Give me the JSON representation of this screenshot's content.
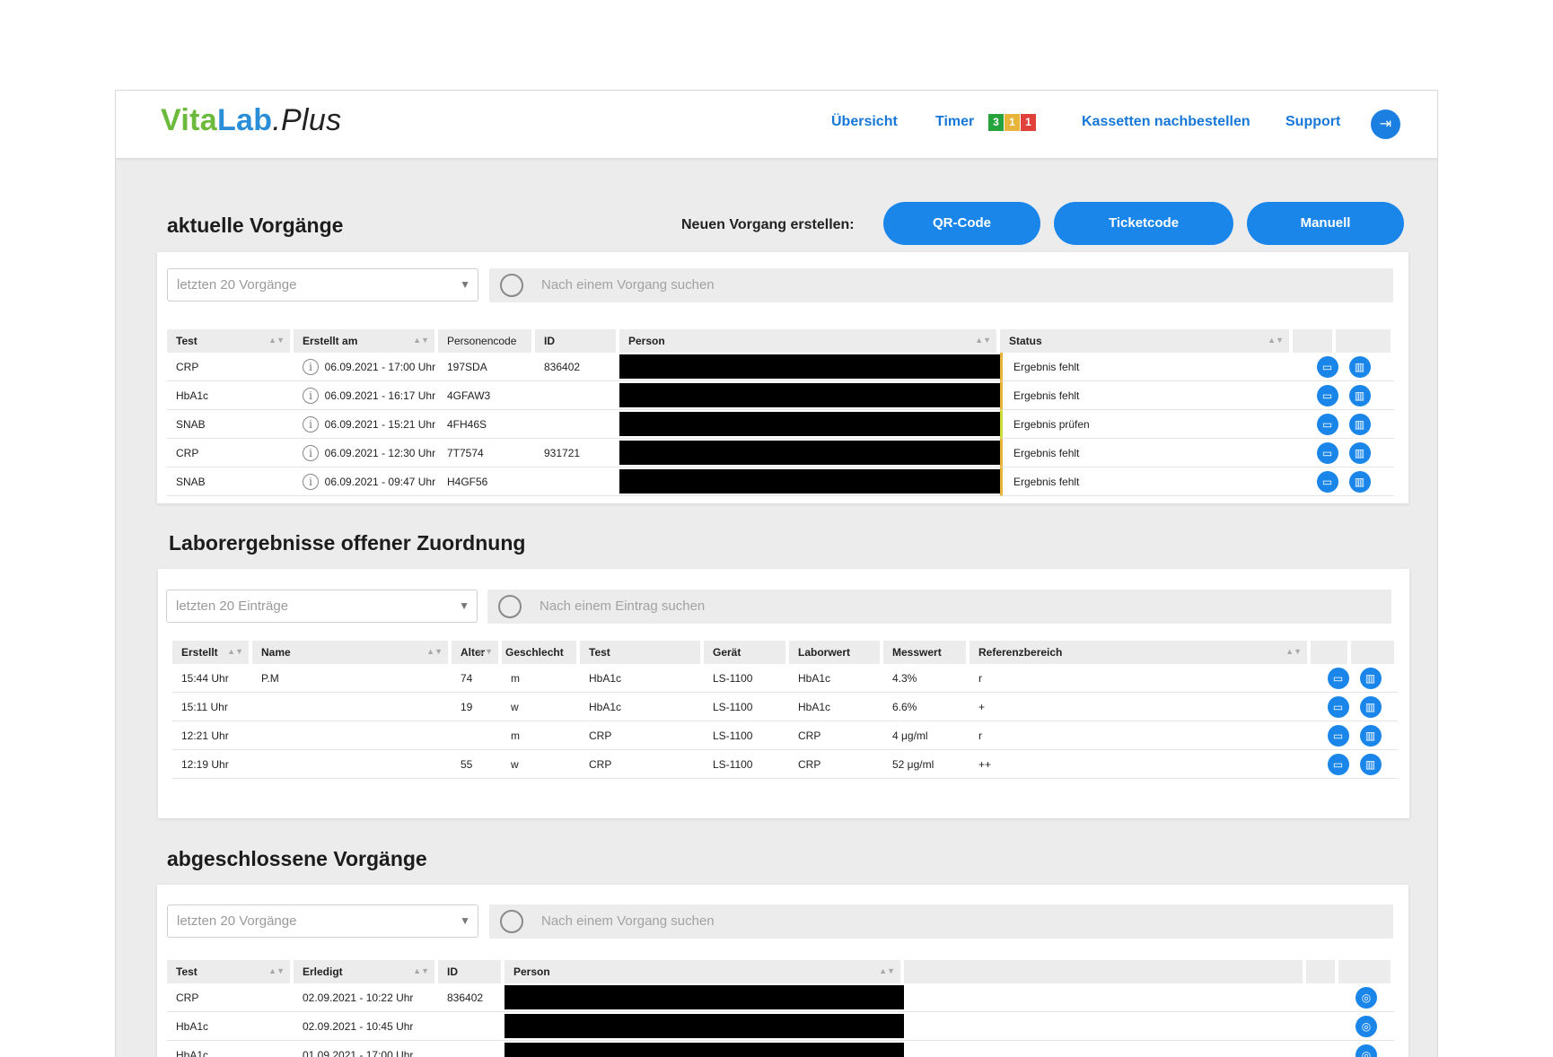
{
  "brand": {
    "part1": "Vita",
    "part2": "Lab",
    "part3": ".Plus"
  },
  "nav": {
    "overview": "Übersicht",
    "timer": "Timer",
    "timer_badges": [
      {
        "value": "3",
        "color": "#27a33e"
      },
      {
        "value": "1",
        "color": "#e9b43a"
      },
      {
        "value": "1",
        "color": "#e0413a"
      }
    ],
    "reorder": "Kassetten nachbestellen",
    "support": "Support"
  },
  "colors": {
    "accent": "#1a86ea",
    "status_missing": "#e9b43a",
    "status_check": "#cddc39"
  },
  "current": {
    "title": "aktuelle Vorgänge",
    "create_label": "Neuen Vorgang erstellen:",
    "buttons": {
      "qr": "QR-Code",
      "ticket": "Ticketcode",
      "manual": "Manuell"
    },
    "filter": "letzten 20 Vorgänge",
    "search_placeholder": "Nach einem Vorgang suchen",
    "columns": {
      "test": "Test",
      "created": "Erstellt am",
      "code": "Personencode",
      "id": "ID",
      "person": "Person",
      "status": "Status"
    },
    "rows": [
      {
        "test": "CRP",
        "created": "06.09.2021 - 17:00 Uhr",
        "code": "197SDA",
        "id": "836402",
        "status": "Ergebnis fehlt"
      },
      {
        "test": "HbA1c",
        "created": "06.09.2021 - 16:17 Uhr",
        "code": "4GFAW3",
        "id": "",
        "status": "Ergebnis fehlt"
      },
      {
        "test": "SNAB",
        "created": "06.09.2021 - 15:21 Uhr",
        "code": "4FH46S",
        "id": "",
        "status": "Ergebnis prüfen"
      },
      {
        "test": "CRP",
        "created": "06.09.2021 - 12:30 Uhr",
        "code": "7T7574",
        "id": "931721",
        "status": "Ergebnis fehlt"
      },
      {
        "test": "SNAB",
        "created": "06.09.2021 - 09:47 Uhr",
        "code": "H4GF56",
        "id": "",
        "status": "Ergebnis fehlt"
      }
    ]
  },
  "lab": {
    "title": "Laborergebnisse offener Zuordnung",
    "filter": "letzten 20 Einträge",
    "search_placeholder": "Nach einem Eintrag suchen",
    "columns": {
      "created": "Erstellt",
      "name": "Name",
      "age": "Alter",
      "sex": "Geschlecht",
      "test": "Test",
      "device": "Gerät",
      "labvalue": "Laborwert",
      "measured": "Messwert",
      "reference": "Referenzbereich"
    },
    "rows": [
      {
        "created": "15:44 Uhr",
        "name": "P.M",
        "age": "74",
        "sex": "m",
        "test": "HbA1c",
        "device": "LS-1100",
        "labvalue": "HbA1c",
        "measured": "4.3%",
        "reference": "r"
      },
      {
        "created": "15:11 Uhr",
        "name": "",
        "age": "19",
        "sex": "w",
        "test": "HbA1c",
        "device": "LS-1100",
        "labvalue": "HbA1c",
        "measured": "6.6%",
        "reference": "+"
      },
      {
        "created": "12:21 Uhr",
        "name": "",
        "age": "",
        "sex": "m",
        "test": "CRP",
        "device": "LS-1100",
        "labvalue": "CRP",
        "measured": "4 μg/ml",
        "reference": "r"
      },
      {
        "created": "12:19 Uhr",
        "name": "",
        "age": "55",
        "sex": "w",
        "test": "CRP",
        "device": "LS-1100",
        "labvalue": "CRP",
        "measured": "52 μg/ml",
        "reference": "++"
      }
    ]
  },
  "done": {
    "title": "abgeschlossene Vorgänge",
    "filter": "letzten 20 Vorgänge",
    "search_placeholder": "Nach einem Vorgang suchen",
    "columns": {
      "test": "Test",
      "done": "Erledigt",
      "id": "ID",
      "person": "Person"
    },
    "rows": [
      {
        "test": "CRP",
        "done": "02.09.2021 - 10:22 Uhr",
        "id": "836402"
      },
      {
        "test": "HbA1c",
        "done": "02.09.2021 - 10:45 Uhr",
        "id": ""
      },
      {
        "test": "HbA1c",
        "done": "01.09.2021 - 17:00 Uhr",
        "id": ""
      }
    ]
  }
}
